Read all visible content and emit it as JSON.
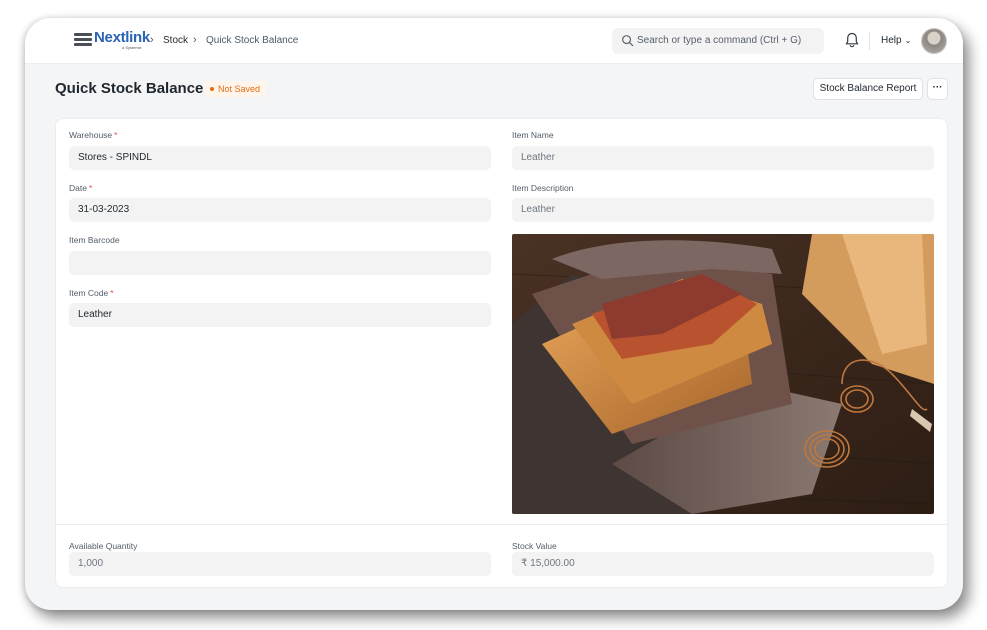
{
  "navbar": {
    "logo_text": "Nextlink",
    "logo_sub": "a Systemix",
    "breadcrumbs": [
      "Stock",
      "Quick Stock Balance"
    ],
    "search_placeholder": "Search or type a command (Ctrl + G)",
    "help_label": "Help"
  },
  "page": {
    "title": "Quick Stock Balance",
    "status": "Not Saved",
    "report_button": "Stock Balance Report",
    "more_button": "···"
  },
  "form": {
    "warehouse": {
      "label": "Warehouse",
      "value": "Stores - SPINDL",
      "required": "*"
    },
    "date": {
      "label": "Date",
      "value": "31-03-2023",
      "required": "*"
    },
    "item_barcode": {
      "label": "Item Barcode",
      "value": ""
    },
    "item_code": {
      "label": "Item Code",
      "value": "Leather",
      "required": "*"
    },
    "item_name": {
      "label": "Item Name",
      "value": "Leather"
    },
    "item_description": {
      "label": "Item Description",
      "value": "Leather"
    },
    "available_qty": {
      "label": "Available Quantity",
      "value": "1,000"
    },
    "stock_value": {
      "label": "Stock Value",
      "value": "₹ 15,000.00"
    }
  },
  "colors": {
    "brand": "#2b63b7",
    "status_orange": "#e86c13",
    "required_red": "#e24c4c"
  },
  "icons": [
    "search-icon",
    "bell-icon",
    "chevron-down-icon",
    "chevron-right-icon",
    "more-icon"
  ]
}
